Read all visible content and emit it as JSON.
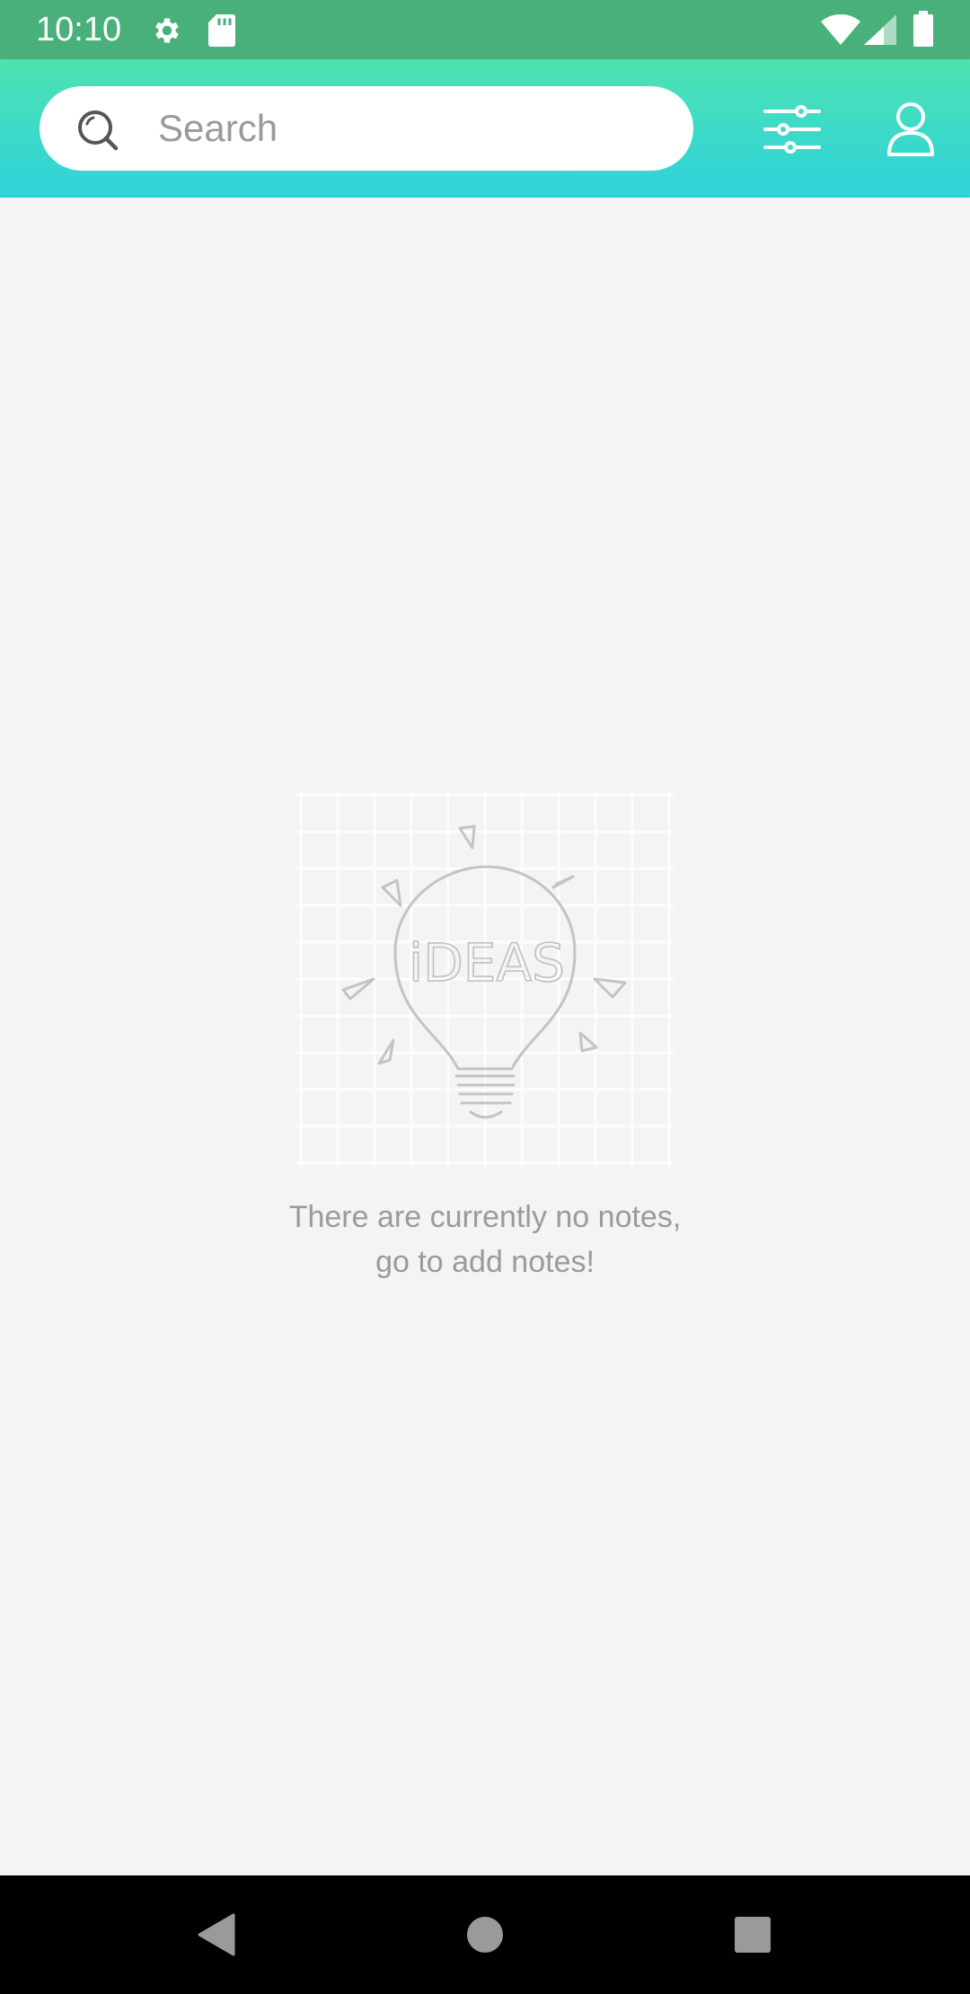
{
  "status_bar": {
    "time": "10:10",
    "icons": [
      "gear-icon",
      "sd-card-icon",
      "wifi-icon",
      "signal-icon",
      "battery-icon"
    ]
  },
  "header": {
    "search": {
      "placeholder": "Search",
      "value": ""
    },
    "filter_icon": "sliders-icon",
    "profile_icon": "person-icon"
  },
  "empty_state": {
    "illustration_word": "iDEAS",
    "line1": "There are currently no notes,",
    "line2": "go to add notes!"
  },
  "nav_bar": {
    "icons": [
      "back-icon",
      "home-icon",
      "recents-icon"
    ]
  },
  "colors": {
    "status_bar": "#49b07a",
    "header_top": "#4ee3b0",
    "header_bottom": "#2fd3da",
    "background": "#f4f3f5",
    "empty_text": "#9b9b9b"
  }
}
